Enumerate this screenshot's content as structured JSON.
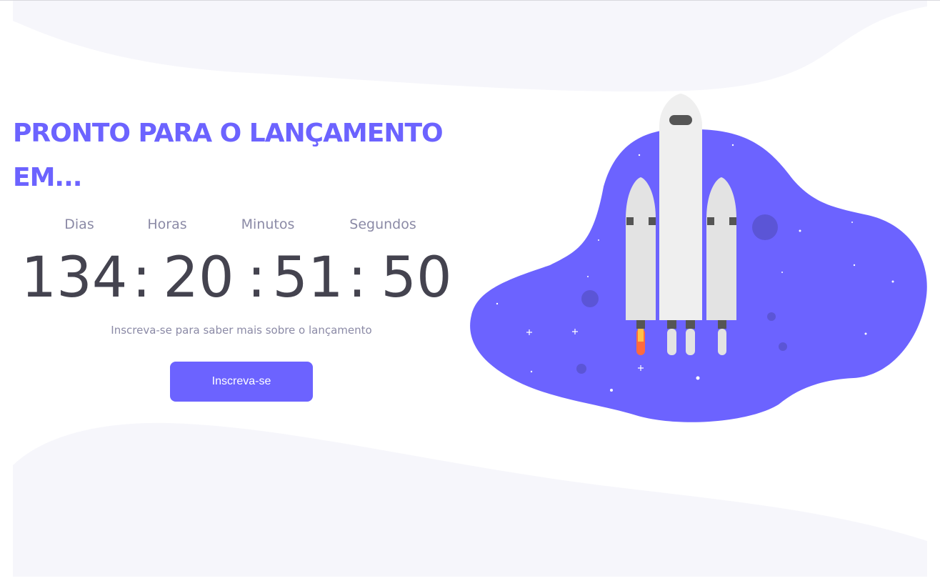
{
  "headline": {
    "line1": "PRONTO PARA O LANÇAMENTO",
    "line2": "EM..."
  },
  "countdown": {
    "labels": {
      "days": "Dias",
      "hours": "Horas",
      "minutes": "Minutos",
      "seconds": "Segundos"
    },
    "values": {
      "days": "134",
      "hours": "20",
      "minutes": "51",
      "seconds": "50"
    },
    "separator": ":"
  },
  "subtitle": "Inscreva-se para saber mais sobre o lançamento",
  "cta": {
    "label": "Inscreva-se"
  },
  "colors": {
    "accent": "#6c63ff",
    "digits": "#44434f",
    "muted": "#8b8aa6",
    "wave": "#f6f6fb"
  },
  "illustration": {
    "icon": "rocket-launch-illustration"
  }
}
